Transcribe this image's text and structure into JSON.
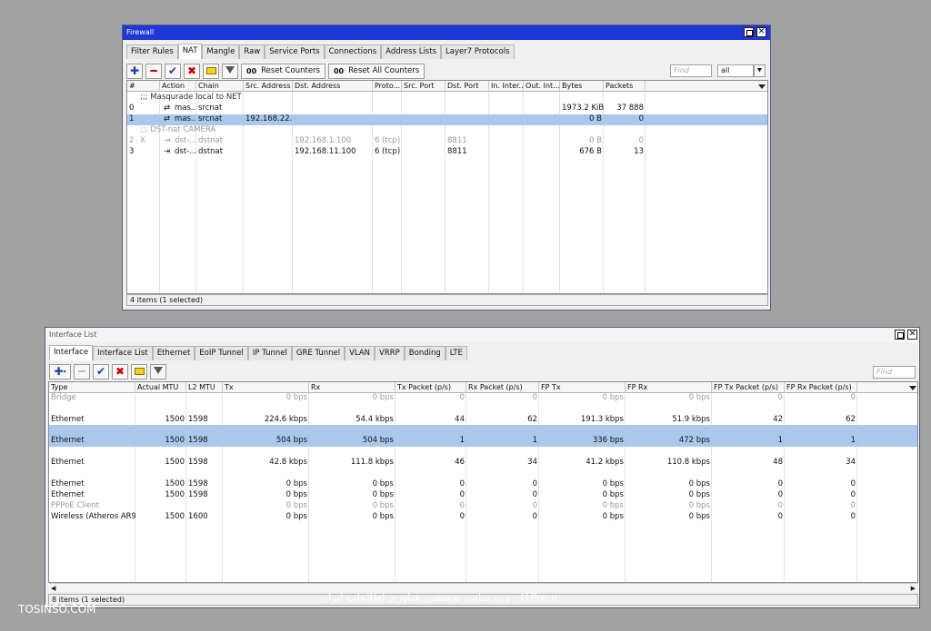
{
  "firewall": {
    "title": "Firewall",
    "tabs": [
      "Filter Rules",
      "NAT",
      "Mangle",
      "Raw",
      "Service Ports",
      "Connections",
      "Address Lists",
      "Layer7 Protocols"
    ],
    "reset_counters": "Reset Counters",
    "reset_all_counters": "Reset All Counters",
    "find_placeholder": "Find",
    "filter_value": "all",
    "columns": [
      "#",
      "Action",
      "Chain",
      "Src. Address",
      "Dst. Address",
      "Proto...",
      "Src. Port",
      "Dst. Port",
      "In. Inter...",
      "Out. Int...",
      "Bytes",
      "Packets"
    ],
    "rows": [
      {
        "type": "comment",
        "text": ";;; Masqurade local to NET"
      },
      {
        "num": "0",
        "flag": "",
        "action": "mas...",
        "chain": "srcnat",
        "src": "",
        "dst": "",
        "proto": "",
        "sport": "",
        "dport": "",
        "bytes": "1973.2 KiB",
        "packets": "37 888"
      },
      {
        "num": "1",
        "flag": "",
        "action": "mas...",
        "chain": "srcnat",
        "src": "192.168.22...",
        "dst": "",
        "proto": "",
        "sport": "",
        "dport": "",
        "bytes": "0 B",
        "packets": "0"
      },
      {
        "type": "comment",
        "text": ";;; DST-nat CAMERA"
      },
      {
        "num": "2",
        "flag": "X",
        "action": "dst-...",
        "chain": "dstnat",
        "src": "",
        "dst": "192.168.1.100",
        "proto": "6 (tcp)",
        "sport": "",
        "dport": "8811",
        "bytes": "0 B",
        "packets": "0"
      },
      {
        "num": "3",
        "flag": "",
        "action": "dst-...",
        "chain": "dstnat",
        "src": "",
        "dst": "192.168.11.100",
        "proto": "6 (tcp)",
        "sport": "",
        "dport": "8811",
        "bytes": "676 B",
        "packets": "13"
      }
    ],
    "status": "4 items (1 selected)"
  },
  "interfaces": {
    "title": "Interface List",
    "tabs": [
      "Interface",
      "Interface List",
      "Ethernet",
      "EoIP Tunnel",
      "IP Tunnel",
      "GRE Tunnel",
      "VLAN",
      "VRRP",
      "Bonding",
      "LTE"
    ],
    "find_placeholder": "Find",
    "columns": [
      "Type",
      "Actual MTU",
      "L2 MTU",
      "Tx",
      "Rx",
      "Tx Packet (p/s)",
      "Rx Packet (p/s)",
      "FP Tx",
      "FP Rx",
      "FP Tx Packet (p/s)",
      "FP Rx Packet (p/s)"
    ],
    "rows": [
      [
        "Bridge",
        "",
        "",
        "0 bps",
        "0 bps",
        "0",
        "0",
        "0 bps",
        "0 bps",
        "0",
        "0"
      ],
      [
        "Ethernet",
        "1500",
        "1598",
        "224.6 kbps",
        "54.4 kbps",
        "44",
        "62",
        "191.3 kbps",
        "51.9 kbps",
        "42",
        "62"
      ],
      [
        "Ethernet",
        "1500",
        "1598",
        "504 bps",
        "504 bps",
        "1",
        "1",
        "336 bps",
        "472 bps",
        "1",
        "1"
      ],
      [
        "Ethernet",
        "1500",
        "1598",
        "42.8 kbps",
        "111.8 kbps",
        "46",
        "34",
        "41.2 kbps",
        "110.8 kbps",
        "48",
        "34"
      ],
      [
        "Ethernet",
        "1500",
        "1598",
        "0 bps",
        "0 bps",
        "0",
        "0",
        "0 bps",
        "0 bps",
        "0",
        "0"
      ],
      [
        "Ethernet",
        "1500",
        "1598",
        "0 bps",
        "0 bps",
        "0",
        "0",
        "0 bps",
        "0 bps",
        "0",
        "0"
      ],
      [
        "PPPoE Client",
        "",
        "",
        "0 bps",
        "0 bps",
        "0",
        "0",
        "0 bps",
        "0 bps",
        "0",
        "0"
      ],
      [
        "Wireless (Atheros AR9...",
        "1500",
        "1600",
        "0 bps",
        "0 bps",
        "0",
        "0",
        "0 bps",
        "0 bps",
        "0",
        "0"
      ]
    ],
    "status": "8 items (1 selected)"
  },
  "watermark_left": "TOSINSO.COM",
  "watermark_center": "وب سایت تخصصی فناوری اطلاعات ایران - ITPro.ir"
}
